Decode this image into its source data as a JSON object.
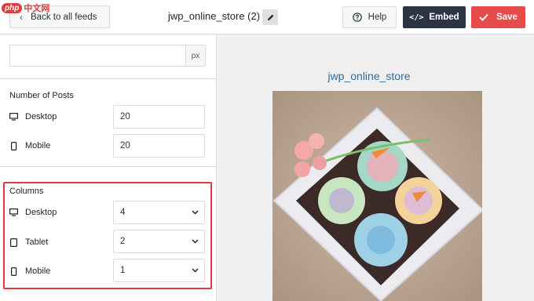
{
  "topbar": {
    "back_label": "Back to all feeds",
    "feed_title": "jwp_online_store (2)",
    "help_label": "Help",
    "embed_label": "Embed",
    "save_label": "Save"
  },
  "watermark": {
    "brand": "php",
    "text": "中文网"
  },
  "settings": {
    "width_unit": "px",
    "number_of_posts": {
      "title": "Number of Posts",
      "desktop_label": "Desktop",
      "desktop_value": "20",
      "mobile_label": "Mobile",
      "mobile_value": "20"
    },
    "columns": {
      "title": "Columns",
      "desktop_label": "Desktop",
      "desktop_value": "4",
      "tablet_label": "Tablet",
      "tablet_value": "2",
      "mobile_label": "Mobile",
      "mobile_value": "1"
    }
  },
  "preview": {
    "account_name": "jwp_online_store"
  },
  "colors": {
    "embed_bg": "#2c3343",
    "save_bg": "#e64c4c",
    "highlight": "#e03a3a",
    "preview_title": "#2d6ca0"
  }
}
